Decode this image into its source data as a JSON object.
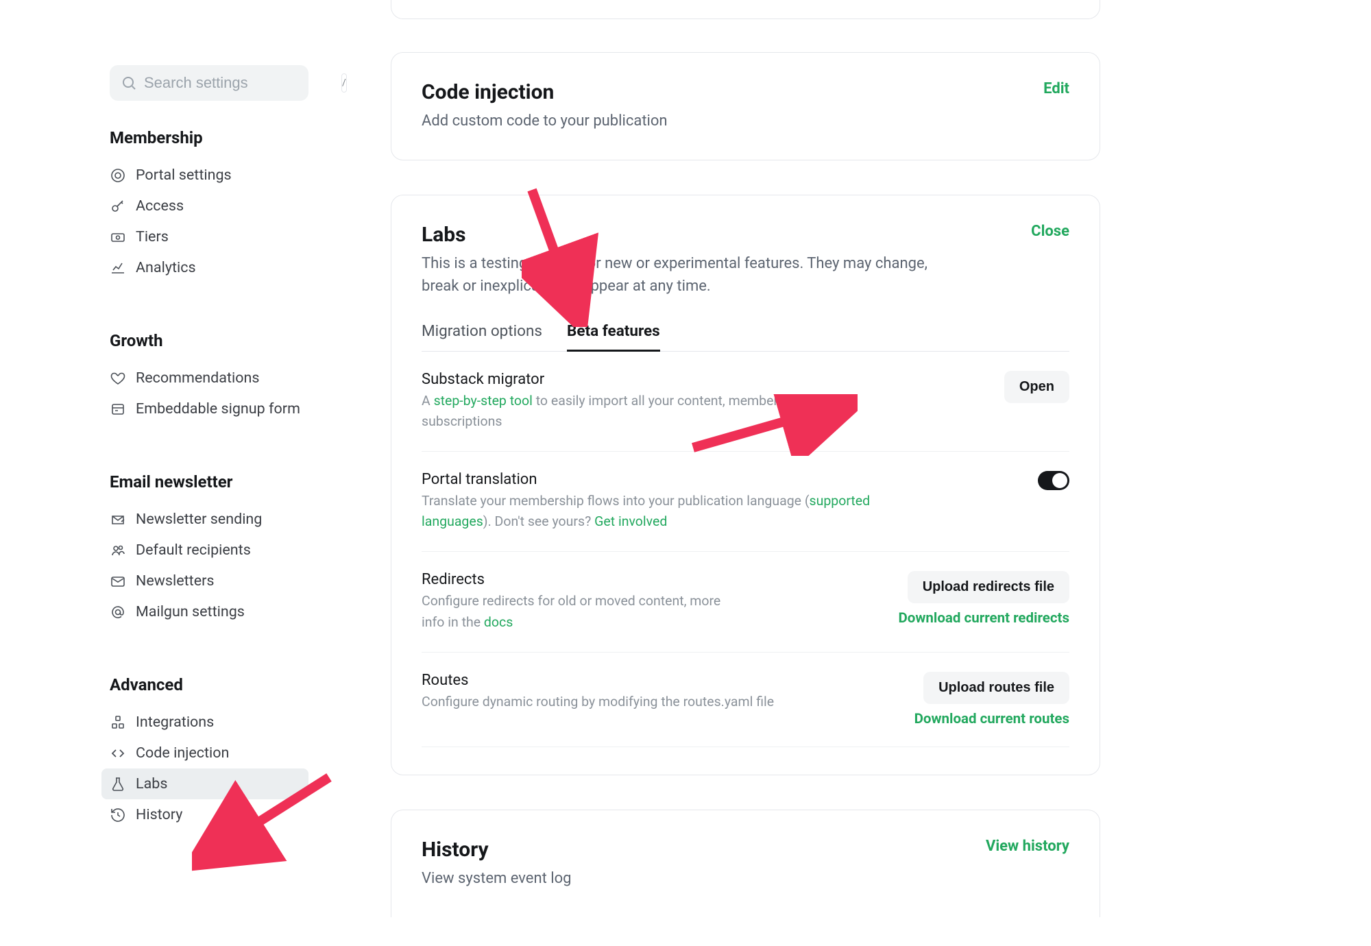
{
  "search": {
    "placeholder": "Search settings",
    "shortcut": "/"
  },
  "sidebar": {
    "groups": [
      {
        "title": "Membership",
        "items": [
          {
            "label": "Portal settings"
          },
          {
            "label": "Access"
          },
          {
            "label": "Tiers"
          },
          {
            "label": "Analytics"
          }
        ]
      },
      {
        "title": "Growth",
        "items": [
          {
            "label": "Recommendations"
          },
          {
            "label": "Embeddable signup form"
          }
        ]
      },
      {
        "title": "Email newsletter",
        "items": [
          {
            "label": "Newsletter sending"
          },
          {
            "label": "Default recipients"
          },
          {
            "label": "Newsletters"
          },
          {
            "label": "Mailgun settings"
          }
        ]
      },
      {
        "title": "Advanced",
        "items": [
          {
            "label": "Integrations"
          },
          {
            "label": "Code injection"
          },
          {
            "label": "Labs"
          },
          {
            "label": "History"
          }
        ]
      }
    ]
  },
  "codeInjection": {
    "title": "Code injection",
    "subtitle": "Add custom code to your publication",
    "action": "Edit"
  },
  "labs": {
    "title": "Labs",
    "subtitle": "This is a testing ground for new or experimental features. They may change, break or inexplicably disappear at any time.",
    "action": "Close",
    "tabs": [
      {
        "label": "Migration options"
      },
      {
        "label": "Beta features"
      }
    ],
    "features": {
      "substack": {
        "title": "Substack migrator",
        "desc_prefix": "A ",
        "desc_link": "step-by-step tool",
        "desc_suffix": " to easily import all your content, members and paid subscriptions",
        "button": "Open"
      },
      "portal": {
        "title": "Portal translation",
        "desc_prefix": "Translate your membership flows into your publication language (",
        "desc_link": "supported languages",
        "desc_mid": "). Don't see yours? ",
        "desc_link2": "Get involved"
      },
      "redirects": {
        "title": "Redirects",
        "desc_prefix": "Configure redirects for old or moved content, more info in the ",
        "desc_link": "docs",
        "upload": "Upload redirects file",
        "download": "Download current redirects"
      },
      "routes": {
        "title": "Routes",
        "desc": "Configure dynamic routing by modifying the routes.yaml file",
        "upload": "Upload routes file",
        "download": "Download current routes"
      }
    }
  },
  "history": {
    "title": "History",
    "subtitle": "View system event log",
    "action": "View history"
  }
}
